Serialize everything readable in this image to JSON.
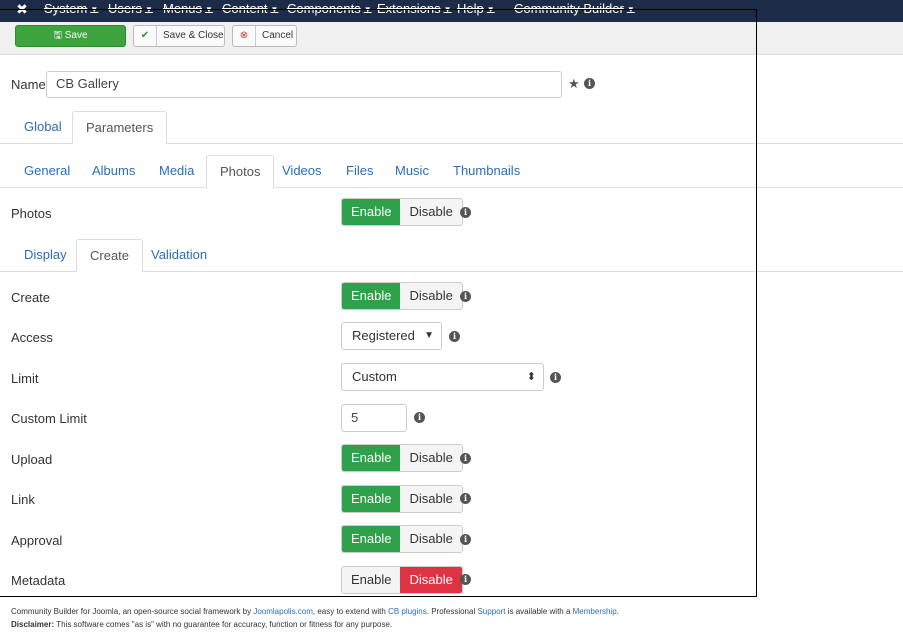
{
  "topbar": {
    "menus": [
      "System",
      "Users",
      "Menus",
      "Content",
      "Components",
      "Extensions",
      "Help",
      "Community Builder"
    ]
  },
  "toolbar": {
    "save_label": "Save",
    "save_close_label": "Save & Close",
    "cancel_label": "Cancel"
  },
  "name_field": {
    "label": "Name",
    "value": "CB Gallery"
  },
  "main_tabs": [
    "Global",
    "Parameters"
  ],
  "sub_tabs": [
    "General",
    "Albums",
    "Media",
    "Photos",
    "Videos",
    "Files",
    "Music",
    "Thumbnails"
  ],
  "photos_row": {
    "label": "Photos",
    "enable": "Enable",
    "disable": "Disable"
  },
  "photo_tabs": [
    "Display",
    "Create",
    "Validation"
  ],
  "settings": {
    "create": {
      "label": "Create",
      "enable": "Enable",
      "disable": "Disable"
    },
    "access": {
      "label": "Access",
      "value": "Registered"
    },
    "limit": {
      "label": "Limit",
      "value": "Custom"
    },
    "custom_limit": {
      "label": "Custom Limit",
      "value": "5"
    },
    "upload": {
      "label": "Upload",
      "enable": "Enable",
      "disable": "Disable"
    },
    "link": {
      "label": "Link",
      "enable": "Enable",
      "disable": "Disable"
    },
    "approval": {
      "label": "Approval",
      "enable": "Enable",
      "disable": "Disable"
    },
    "metadata": {
      "label": "Metadata",
      "enable": "Enable",
      "disable": "Disable"
    }
  },
  "footer": {
    "line1_a": "Community Builder for Joomla, an open-source social framework by ",
    "link1": "Joomlapolis.com",
    "line1_b": ", easy to extend with ",
    "link2": "CB plugins",
    "line1_c": ". Professional ",
    "link3": "Support",
    "line1_d": " is available with a ",
    "link4": "Membership",
    "line1_e": ".",
    "disclaimer_label": "Disclaimer:",
    "disclaimer_text": " This software comes \"as is\" with no guarantee for accuracy, function or fitness for any purpose."
  },
  "colors": {
    "enable_green": "#2fa14a",
    "disable_red": "#dd3344",
    "topbar": "#1c2b48",
    "link": "#2a6ebb"
  }
}
